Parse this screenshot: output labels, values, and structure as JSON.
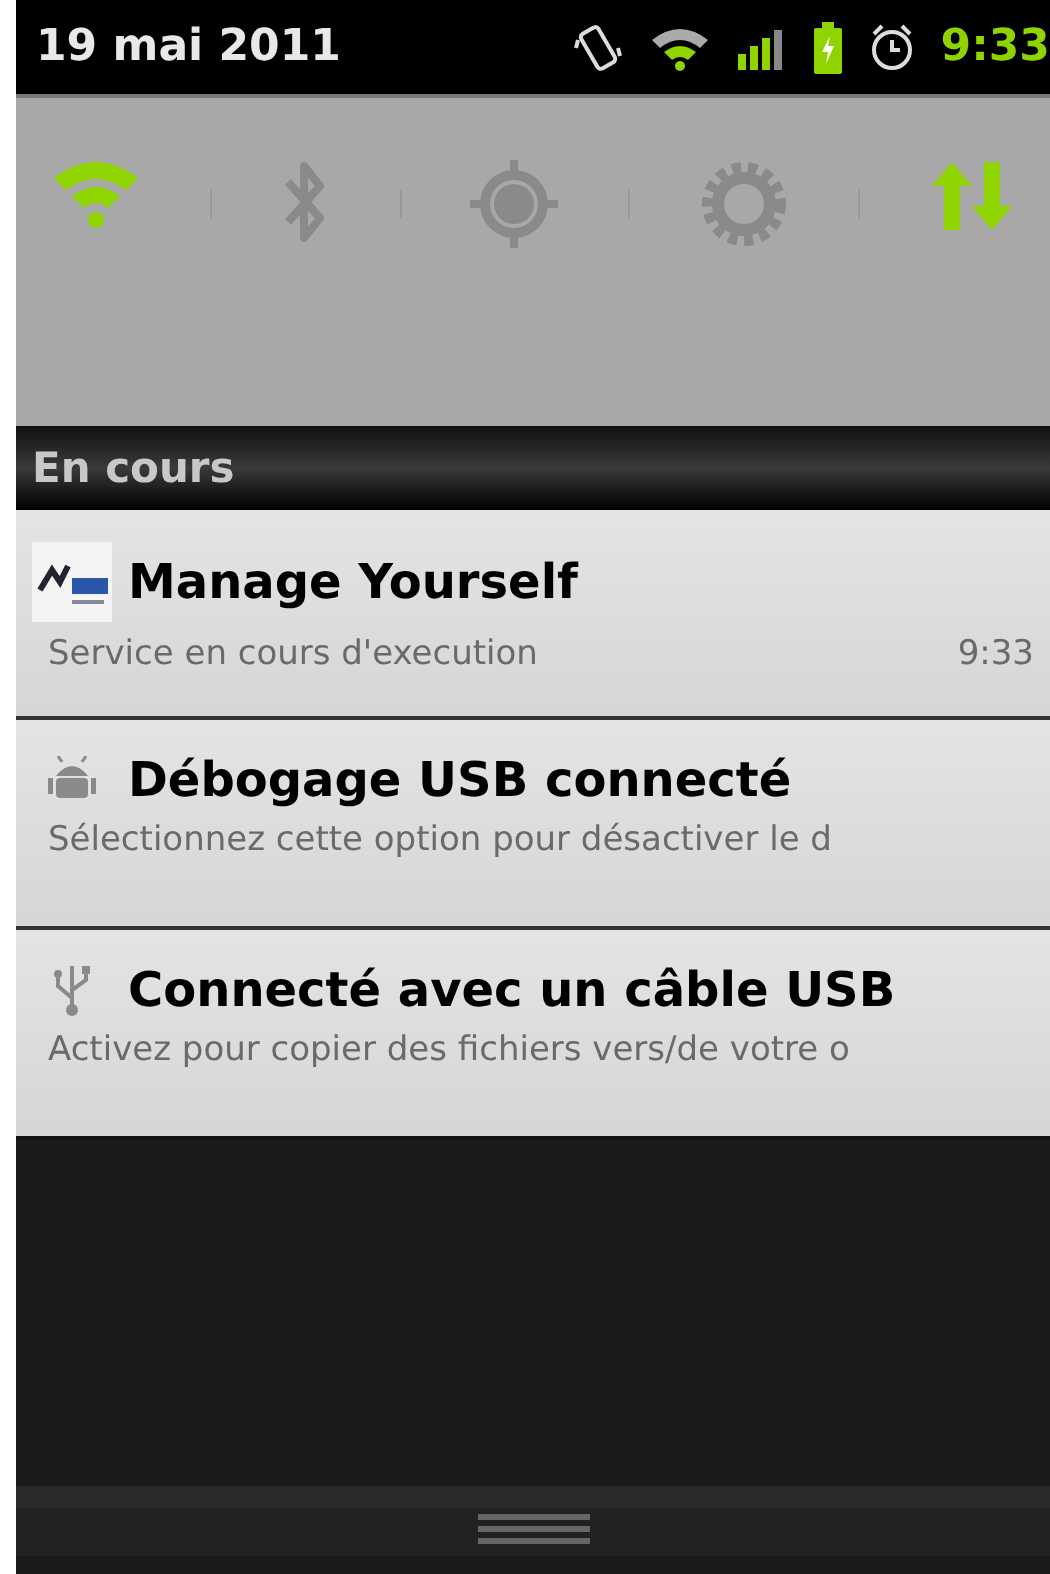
{
  "status_bar": {
    "date": "19 mai 2011",
    "time": "9:33"
  },
  "quick_toggles": [
    {
      "kind": "wifi",
      "on": true
    },
    {
      "kind": "bluetooth",
      "on": false
    },
    {
      "kind": "gps",
      "on": false
    },
    {
      "kind": "sync",
      "on": false
    },
    {
      "kind": "data",
      "on": true
    }
  ],
  "section": {
    "title": "En cours"
  },
  "notifications": [
    {
      "kind": "app",
      "title": "Manage Yourself",
      "text": "Service en cours d'execution",
      "time": "9:33"
    },
    {
      "kind": "debug",
      "title": "Débogage USB connecté",
      "text": "Sélectionnez cette option pour désactiver le d"
    },
    {
      "kind": "usb",
      "title": "Connecté avec un câble USB",
      "text": "Activez pour copier des fichiers vers/de votre o"
    }
  ]
}
